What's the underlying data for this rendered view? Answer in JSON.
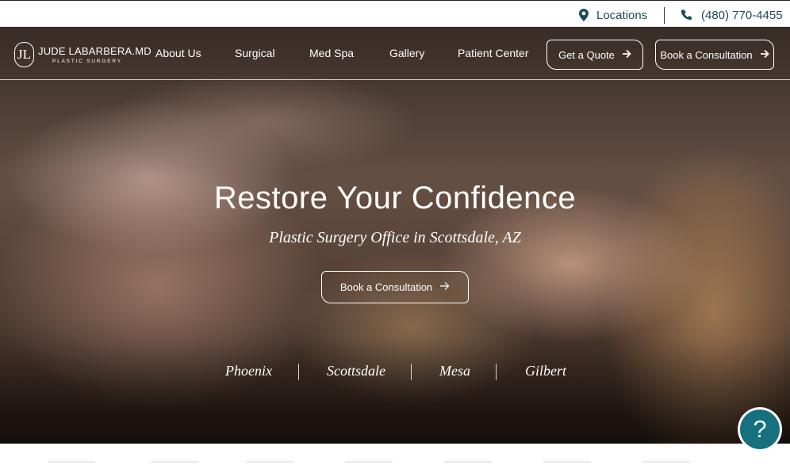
{
  "topbar": {
    "locations_label": "Locations",
    "locations_icon": "map-pin-icon",
    "phone_label": "(480) 770-4455",
    "phone_icon": "phone-icon"
  },
  "brand": {
    "monogram": "JL",
    "name": "JUDE LABARBERA.MD",
    "tagline": "PLASTIC SURGERY"
  },
  "nav": {
    "links": [
      "About Us",
      "Surgical",
      "Med Spa",
      "Gallery",
      "Patient Center"
    ],
    "quote_button": "Get a Quote",
    "consult_button": "Book a Consultation"
  },
  "hero": {
    "headline": "Restore Your Confidence",
    "subheadline": "Plastic Surgery Office in Scottsdale, AZ",
    "cta_label": "Book a Consultation",
    "cities": [
      "Phoenix",
      "Scottsdale",
      "Mesa",
      "Gilbert"
    ]
  },
  "help": {
    "icon": "question-icon",
    "glyph": "?"
  },
  "colors": {
    "accent_teal": "#16707d",
    "topbar_text": "#1f4a57"
  }
}
